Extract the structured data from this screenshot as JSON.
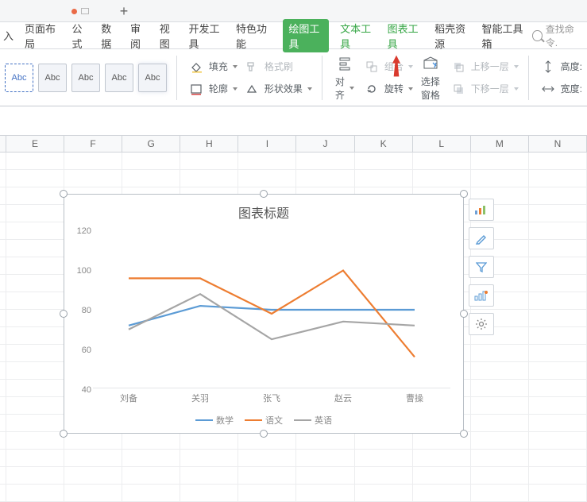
{
  "window": {
    "plus": "+"
  },
  "menu": {
    "items": [
      "入",
      "页面布局",
      "公式",
      "数据",
      "审阅",
      "视图",
      "开发工具",
      "特色功能"
    ],
    "pill": "绘图工具",
    "green": [
      "文本工具",
      "图表工具"
    ],
    "rest": [
      "稻壳资源",
      "智能工具箱"
    ],
    "search_placeholder": "查找命令."
  },
  "ribbon": {
    "preset_label": "Abc",
    "fill": "填充",
    "outline": "轮廓",
    "format_brush": "格式刷",
    "shape_effect": "形状效果",
    "align": "对齐",
    "group": "组合",
    "rotate": "旋转",
    "select_pane": "选择窗格",
    "bring_forward": "上移一层",
    "send_backward": "下移一层",
    "height": "高度:",
    "width": "宽度:"
  },
  "columns": [
    "E",
    "F",
    "G",
    "H",
    "I",
    "J",
    "K",
    "L",
    "M",
    "N"
  ],
  "chart_data": {
    "type": "line",
    "title": "图表标题",
    "categories": [
      "刘备",
      "关羽",
      "张飞",
      "赵云",
      "曹操"
    ],
    "series": [
      {
        "name": "数学",
        "values": [
          72,
          82,
          80,
          80,
          80
        ],
        "color": "#5b9bd5"
      },
      {
        "name": "语文",
        "values": [
          96,
          96,
          78,
          100,
          56
        ],
        "color": "#ed7d31"
      },
      {
        "name": "英语",
        "values": [
          70,
          88,
          65,
          74,
          72
        ],
        "color": "#a5a5a5"
      }
    ],
    "ylim": [
      40,
      120
    ],
    "yticks": [
      40,
      60,
      80,
      100,
      120
    ],
    "xlabel": "",
    "ylabel": ""
  },
  "side_buttons": [
    "chart-type-icon",
    "style-icon",
    "filter-icon",
    "design-icon",
    "settings-icon"
  ]
}
